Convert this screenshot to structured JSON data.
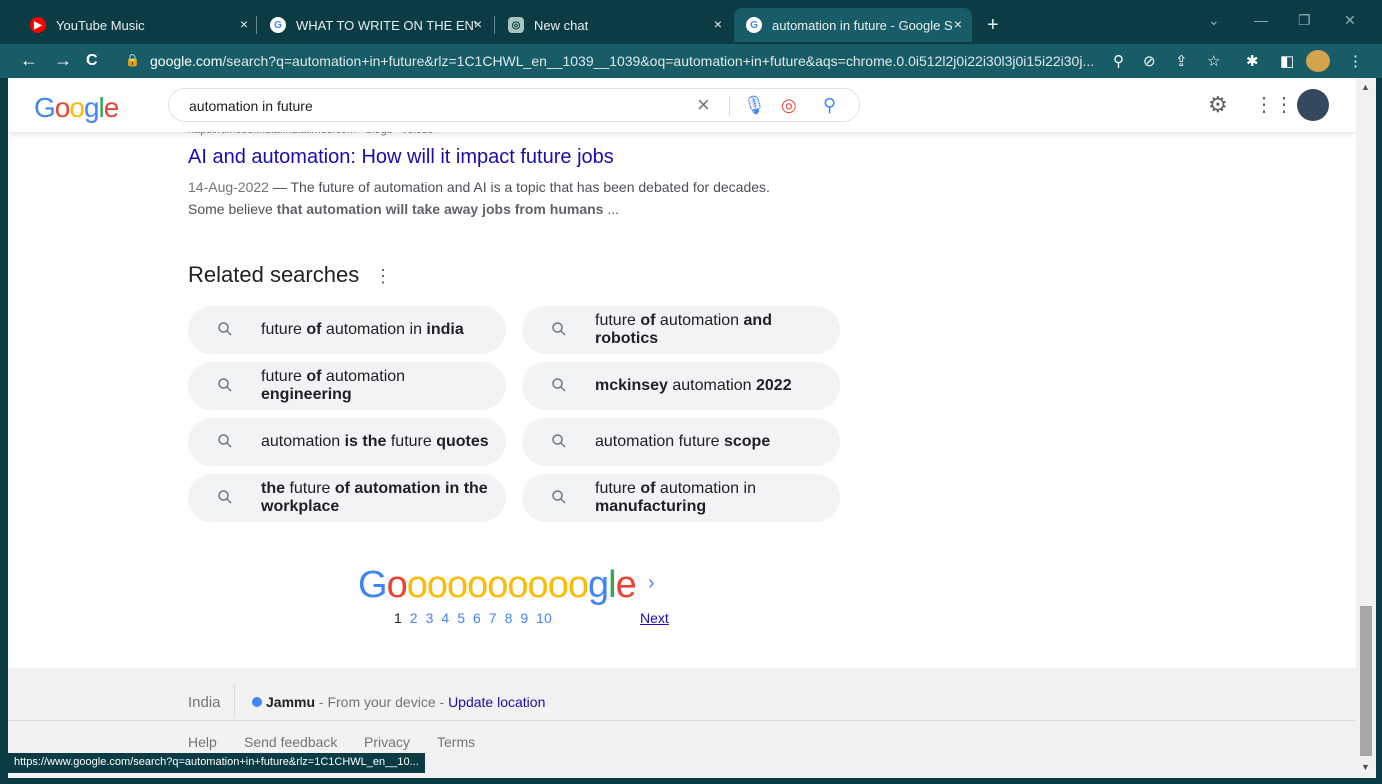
{
  "tabs": [
    {
      "title": "YouTube Music",
      "close": "×"
    },
    {
      "title": "WHAT TO WRITE ON THE ENVELO",
      "close": "×"
    },
    {
      "title": "New chat",
      "close": "×"
    },
    {
      "title": "automation in future - Google Se",
      "close": "×"
    }
  ],
  "new_tab": "+",
  "toolbar": {
    "back": "←",
    "forward": "→",
    "reload": "C",
    "url_host": "google.com",
    "url_path": "/search?q=automation+in+future&rlz=1C1CHWL_en__1039__1039&oq=automation+in+future&aqs=chrome.0.0i512l2j0i22i30l3j0i15i22i30j..."
  },
  "search": {
    "logo": "Google",
    "query": "automation in future",
    "clear": "×"
  },
  "result": {
    "url_cut": "https://timesofindia.indiatimes.com › blogs › voices",
    "title": "AI and automation: How will it impact future jobs",
    "date": "14-Aug-2022",
    "snippet_pre": " — The future of automation and AI is a topic that has been debated for decades. Some believe ",
    "snippet_bold": "that automation will take away jobs from humans",
    "snippet_post": " ..."
  },
  "related": {
    "title": "Related searches",
    "more": "⋮",
    "items": [
      [
        "future ",
        "of",
        " automation in ",
        "india"
      ],
      [
        "future ",
        "of",
        " automation ",
        "and robotics"
      ],
      [
        "future ",
        "of",
        " automation ",
        "engineering"
      ],
      [
        "",
        "mckinsey",
        " automation ",
        "2022"
      ],
      [
        "automation ",
        "is the",
        " future ",
        "quotes"
      ],
      [
        "",
        "",
        "automation future ",
        "scope"
      ],
      [
        "",
        "the",
        " future ",
        "of automation in the workplace"
      ],
      [
        "future ",
        "of",
        " automation in ",
        "manufacturing"
      ]
    ]
  },
  "pagination": {
    "logo_prefix": "G",
    "logo_os": "oooooooooo",
    "logo_suffix": "gle",
    "arrow": "›",
    "pages": [
      "1",
      "2",
      "3",
      "4",
      "5",
      "6",
      "7",
      "8",
      "9",
      "10"
    ],
    "next": "Next"
  },
  "footer": {
    "country": "India",
    "location": "Jammu",
    "from_device": " - From your device - ",
    "update": "Update location",
    "links": [
      "Help",
      "Send feedback",
      "Privacy",
      "Terms"
    ]
  },
  "status_url": "https://www.google.com/search?q=automation+in+future&rlz=1C1CHWL_en__10..."
}
